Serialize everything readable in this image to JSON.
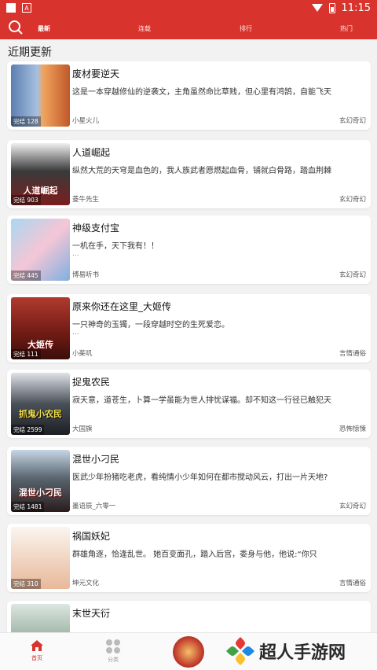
{
  "status_bar": {
    "time": "11:15",
    "badge": "A"
  },
  "nav": {
    "tabs": [
      {
        "label": "最新",
        "active": true
      },
      {
        "label": "连载",
        "active": false
      },
      {
        "label": "排行",
        "active": false
      },
      {
        "label": "热门",
        "active": false
      }
    ]
  },
  "section_title": "近期更新",
  "books": [
    {
      "title": "废材要逆天",
      "desc": "这是一本穿越修仙的逆袭文，主角虽然命比草贱，但心里有鸿鹄，自能飞天",
      "author": "小星火儿",
      "genre": "玄幻奇幻",
      "badge": "完结 128",
      "cover_text": "",
      "has_dots": false
    },
    {
      "title": "人道崛起",
      "desc": "纵然大荒的天穹是血色的，我人族武者愿燃起血骨，铺就白骨路，踏血荆棘",
      "author": "菱牛先生",
      "genre": "玄幻奇幻",
      "badge": "完结 903",
      "cover_text": "人道崛起",
      "has_dots": false
    },
    {
      "title": "神级支付宝",
      "desc": "一机在手，天下我有！！",
      "author": "博易听书",
      "genre": "玄幻奇幻",
      "badge": "完结 445",
      "cover_text": "",
      "has_dots": true
    },
    {
      "title": "原来你还在这里_大姬传",
      "desc": " 一只神奇的玉镯，一段穿越时空的生死爱恋。",
      "author": "小茱叽",
      "genre": "言情通俗",
      "badge": "完结 111",
      "cover_text": "大姬传",
      "has_dots": true
    },
    {
      "title": "捉鬼农民",
      "desc": "寂天意，道苍生，卜算一学虽能为世人排忧谋福。却不知这一行径已触犯天",
      "author": "大国旗",
      "genre": "恐怖惊悚",
      "badge": "完结 2599",
      "cover_text": "抓鬼小农民",
      "has_dots": false
    },
    {
      "title": "混世小刁民",
      "desc": "医武少年扮猪吃老虎，看纯情小少年如何在都市搅动风云，打出一片天地?",
      "author": "墨语辰_六零一",
      "genre": "玄幻奇幻",
      "badge": "完结 1481",
      "cover_text": "混世小刁民",
      "has_dots": false
    },
    {
      "title": "祸国妖妃",
      "desc": "群雄角逐，恰逢乱世。 她百变面孔，踏入后宫，委身与他，他说:“你只",
      "author": "坤元文化",
      "genre": "言情通俗",
      "badge": "完结 310",
      "cover_text": "",
      "has_dots": false
    },
    {
      "title": "末世天衍",
      "desc": "",
      "author": "",
      "genre": "",
      "badge": "",
      "cover_text": "",
      "has_dots": false
    }
  ],
  "bottom_nav": {
    "home_label": "首页",
    "category_label": "分类"
  },
  "watermark": {
    "text": "超人手游网"
  },
  "colors": {
    "brand": "#d8332c"
  }
}
